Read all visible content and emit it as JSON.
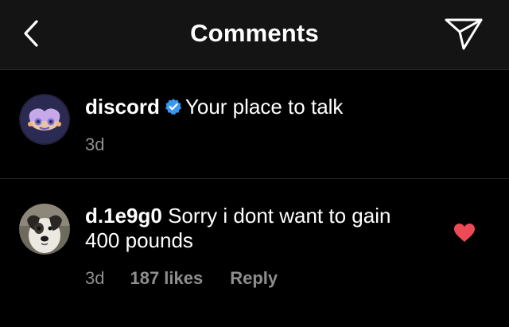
{
  "header": {
    "title": "Comments",
    "back_icon": "chevron-left-icon",
    "share_icon": "paper-plane-icon"
  },
  "caption": {
    "username": "discord",
    "verified": true,
    "text": "Your place to talk",
    "time": "3d"
  },
  "comments": [
    {
      "username": "d.1e9g0",
      "text": "Sorry i dont want to gain 400 pounds",
      "time": "3d",
      "likes": "187 likes",
      "reply": "Reply",
      "liked": true
    }
  ],
  "colors": {
    "background": "#000000",
    "header": "#141414",
    "muted": "#8e8e8e",
    "verified": "#3897f0",
    "heart": "#ed4956"
  }
}
